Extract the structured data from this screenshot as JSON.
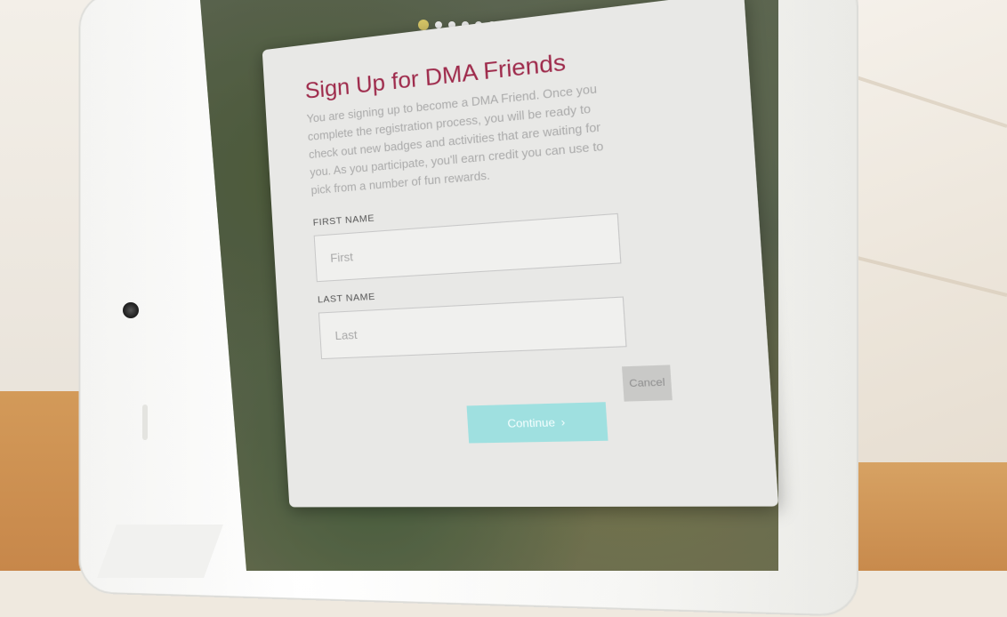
{
  "pager": {
    "total": 7,
    "active_index": 0
  },
  "modal": {
    "title": "Sign Up for DMA Friends",
    "body": "You are signing up to become a DMA Friend. Once you complete the registration process, you will be ready to check out new badges and activities that are waiting for you. As you participate, you'll earn credit you can use to pick from a number of fun rewards.",
    "first_name": {
      "label": "FIRST NAME",
      "placeholder": "First",
      "value": ""
    },
    "last_name": {
      "label": "LAST NAME",
      "placeholder": "Last",
      "value": ""
    },
    "continue_label": "Continue",
    "continue_icon": "chevron-right-icon",
    "cancel_label": "Cancel"
  },
  "colors": {
    "title": "#9e2a4b",
    "continue_bg": "#9fe0e0",
    "cancel_bg": "#c9c9c7",
    "active_dot": "#d6c566"
  }
}
